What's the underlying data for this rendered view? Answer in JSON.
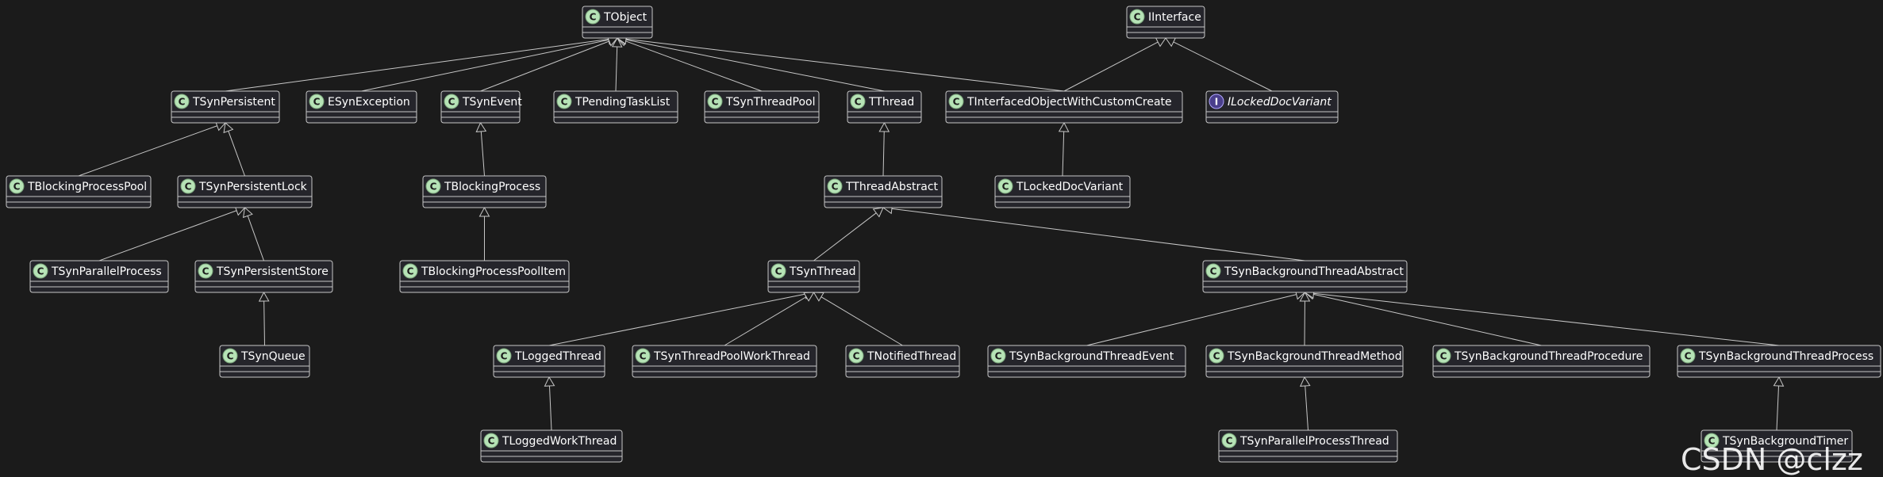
{
  "diagram": {
    "classes": [
      {
        "id": "tobject",
        "name": "TObject",
        "kind": "class"
      },
      {
        "id": "iinterface",
        "name": "IInterface",
        "kind": "class"
      },
      {
        "id": "tsynpersistent",
        "name": "TSynPersistent",
        "kind": "class"
      },
      {
        "id": "esynexception",
        "name": "ESynException",
        "kind": "class"
      },
      {
        "id": "tsynevent",
        "name": "TSynEvent",
        "kind": "class"
      },
      {
        "id": "tpendingtasklist",
        "name": "TPendingTaskList",
        "kind": "class"
      },
      {
        "id": "tsynthreadpool",
        "name": "TSynThreadPool",
        "kind": "class"
      },
      {
        "id": "tthread",
        "name": "TThread",
        "kind": "class"
      },
      {
        "id": "tinterfacedobjectwithcustomcreate",
        "name": "TInterfacedObjectWithCustomCreate",
        "kind": "class"
      },
      {
        "id": "ilockeddocvariant",
        "name": "ILockedDocVariant",
        "kind": "interface"
      },
      {
        "id": "tblockingprocesspool",
        "name": "TBlockingProcessPool",
        "kind": "class"
      },
      {
        "id": "tsynpersistentlock",
        "name": "TSynPersistentLock",
        "kind": "class"
      },
      {
        "id": "tblockingprocess",
        "name": "TBlockingProcess",
        "kind": "class"
      },
      {
        "id": "tthreadabstract",
        "name": "TThreadAbstract",
        "kind": "class"
      },
      {
        "id": "tlockeddocvariant",
        "name": "TLockedDocVariant",
        "kind": "class"
      },
      {
        "id": "tsynparallelprocess",
        "name": "TSynParallelProcess",
        "kind": "class"
      },
      {
        "id": "tsynpersistentstore",
        "name": "TSynPersistentStore",
        "kind": "class"
      },
      {
        "id": "tblockingprocesspoolitem",
        "name": "TBlockingProcessPoolItem",
        "kind": "class"
      },
      {
        "id": "tsynthread",
        "name": "TSynThread",
        "kind": "class"
      },
      {
        "id": "tsynbackgroundthreadabstract",
        "name": "TSynBackgroundThreadAbstract",
        "kind": "class"
      },
      {
        "id": "tsynqueue",
        "name": "TSynQueue",
        "kind": "class"
      },
      {
        "id": "tloggedthread",
        "name": "TLoggedThread",
        "kind": "class"
      },
      {
        "id": "tsynthreadpoolworkthread",
        "name": "TSynThreadPoolWorkThread",
        "kind": "class"
      },
      {
        "id": "tnotifiedthread",
        "name": "TNotifiedThread",
        "kind": "class"
      },
      {
        "id": "tsynbackgroundthreadevent",
        "name": "TSynBackgroundThreadEvent",
        "kind": "class"
      },
      {
        "id": "tsynbackgroundthreadmethod",
        "name": "TSynBackgroundThreadMethod",
        "kind": "class"
      },
      {
        "id": "tsynbackgroundthreadprocedure",
        "name": "TSynBackgroundThreadProcedure",
        "kind": "class"
      },
      {
        "id": "tsynbackgroundthreadprocess",
        "name": "TSynBackgroundThreadProcess",
        "kind": "class"
      },
      {
        "id": "tloggedworkthread",
        "name": "TLoggedWorkThread",
        "kind": "class"
      },
      {
        "id": "tsynparallelprocessthread",
        "name": "TSynParallelProcessThread",
        "kind": "class"
      },
      {
        "id": "tsynbackgroundtimer",
        "name": "TSynBackgroundTimer",
        "kind": "class"
      }
    ],
    "inheritance": [
      {
        "child": "tsynpersistent",
        "parent": "tobject"
      },
      {
        "child": "esynexception",
        "parent": "tobject"
      },
      {
        "child": "tsynevent",
        "parent": "tobject"
      },
      {
        "child": "tpendingtasklist",
        "parent": "tobject"
      },
      {
        "child": "tsynthreadpool",
        "parent": "tobject"
      },
      {
        "child": "tthread",
        "parent": "tobject"
      },
      {
        "child": "tinterfacedobjectwithcustomcreate",
        "parent": "tobject"
      },
      {
        "child": "tinterfacedobjectwithcustomcreate",
        "parent": "iinterface"
      },
      {
        "child": "ilockeddocvariant",
        "parent": "iinterface"
      },
      {
        "child": "tblockingprocesspool",
        "parent": "tsynpersistent"
      },
      {
        "child": "tsynpersistentlock",
        "parent": "tsynpersistent"
      },
      {
        "child": "tblockingprocess",
        "parent": "tsynevent"
      },
      {
        "child": "tthreadabstract",
        "parent": "tthread"
      },
      {
        "child": "tlockeddocvariant",
        "parent": "tinterfacedobjectwithcustomcreate"
      },
      {
        "child": "tsynparallelprocess",
        "parent": "tsynpersistentlock"
      },
      {
        "child": "tsynpersistentstore",
        "parent": "tsynpersistentlock"
      },
      {
        "child": "tblockingprocesspoolitem",
        "parent": "tblockingprocess"
      },
      {
        "child": "tsynthread",
        "parent": "tthreadabstract"
      },
      {
        "child": "tsynbackgroundthreadabstract",
        "parent": "tthreadabstract"
      },
      {
        "child": "tsynqueue",
        "parent": "tsynpersistentstore"
      },
      {
        "child": "tloggedthread",
        "parent": "tsynthread"
      },
      {
        "child": "tsynthreadpoolworkthread",
        "parent": "tsynthread"
      },
      {
        "child": "tnotifiedthread",
        "parent": "tsynthread"
      },
      {
        "child": "tsynbackgroundthreadevent",
        "parent": "tsynbackgroundthreadabstract"
      },
      {
        "child": "tsynbackgroundthreadmethod",
        "parent": "tsynbackgroundthreadabstract"
      },
      {
        "child": "tsynbackgroundthreadprocedure",
        "parent": "tsynbackgroundthreadabstract"
      },
      {
        "child": "tsynbackgroundthreadprocess",
        "parent": "tsynbackgroundthreadabstract"
      },
      {
        "child": "tloggedworkthread",
        "parent": "tloggedthread"
      },
      {
        "child": "tsynparallelprocessthread",
        "parent": "tsynbackgroundthreadmethod"
      },
      {
        "child": "tsynbackgroundtimer",
        "parent": "tsynbackgroundthreadprocess"
      }
    ],
    "badge_letters": {
      "class": "C",
      "interface": "I"
    },
    "colors": {
      "background": "#1b1b1b",
      "box_fill": "#25252b",
      "line": "#c7c7c7",
      "class_badge": "#b6e3b6",
      "interface_badge": "#4a3f8c"
    }
  },
  "watermark": "CSDN @clzz"
}
